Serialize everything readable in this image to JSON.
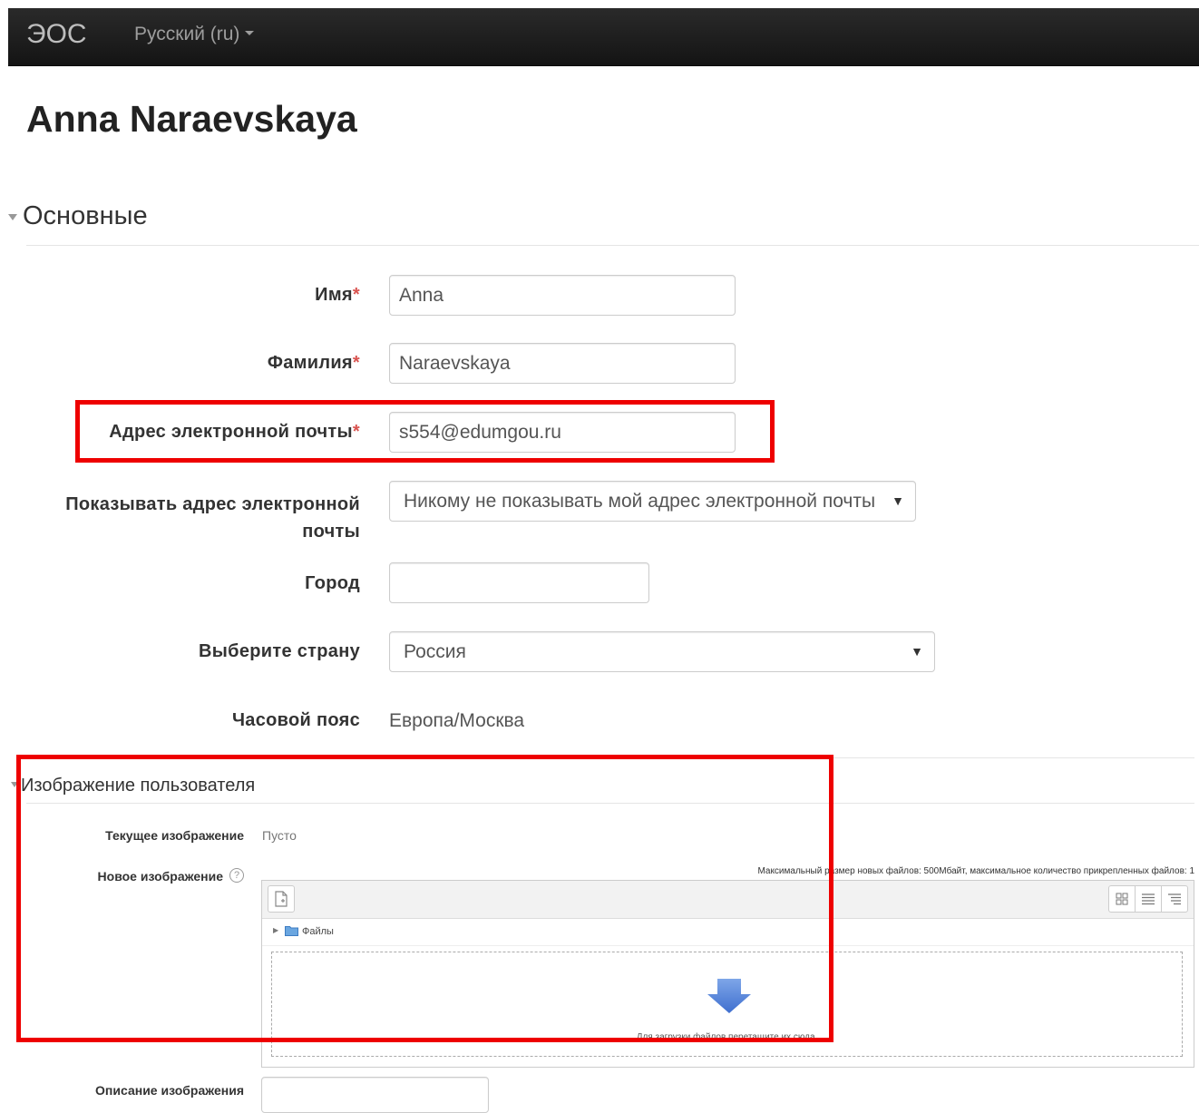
{
  "navbar": {
    "brand": "ЭОС",
    "language": "Русский (ru)"
  },
  "page": {
    "title": "Anna Naraevskaya"
  },
  "general": {
    "section_title": "Основные",
    "first_name_label": "Имя",
    "first_name_value": "Anna",
    "last_name_label": "Фамилия",
    "last_name_value": "Naraevskaya",
    "email_label": "Адрес электронной почты",
    "email_value": "s554@edumgou.ru",
    "email_display_label_1": "Показывать адрес электронной",
    "email_display_label_2": "почты",
    "email_display_value": "Никому не показывать мой адрес электронной почты",
    "city_label": "Город",
    "city_value": "",
    "country_label": "Выберите страну",
    "country_value": "Россия",
    "timezone_label": "Часовой пояс",
    "timezone_value": "Европа/Москва",
    "required_mark": "*"
  },
  "user_picture": {
    "section_title": "Изображение пользователя",
    "current_label": "Текущее изображение",
    "current_value": "Пусто",
    "new_label": "Новое изображение",
    "limits": "Максимальный размер новых файлов: 500Мбайт, максимальное количество прикрепленных файлов: 1",
    "folder": "Файлы",
    "drop_hint": "Для загрузки файлов перетащите их сюда.",
    "description_label": "Описание изображения",
    "description_value": ""
  },
  "colors": {
    "highlight": "#ee0000",
    "required": "#d9534f",
    "navbar": "#1b1b1b",
    "arrow": "#4a7fd6"
  },
  "icons": [
    "caret-down-icon",
    "collapse-triangle-icon",
    "help-icon",
    "add-file-icon",
    "grid-view-icon",
    "list-view-icon",
    "tree-view-icon",
    "folder-icon",
    "download-arrow-icon",
    "select-arrow-icon"
  ]
}
